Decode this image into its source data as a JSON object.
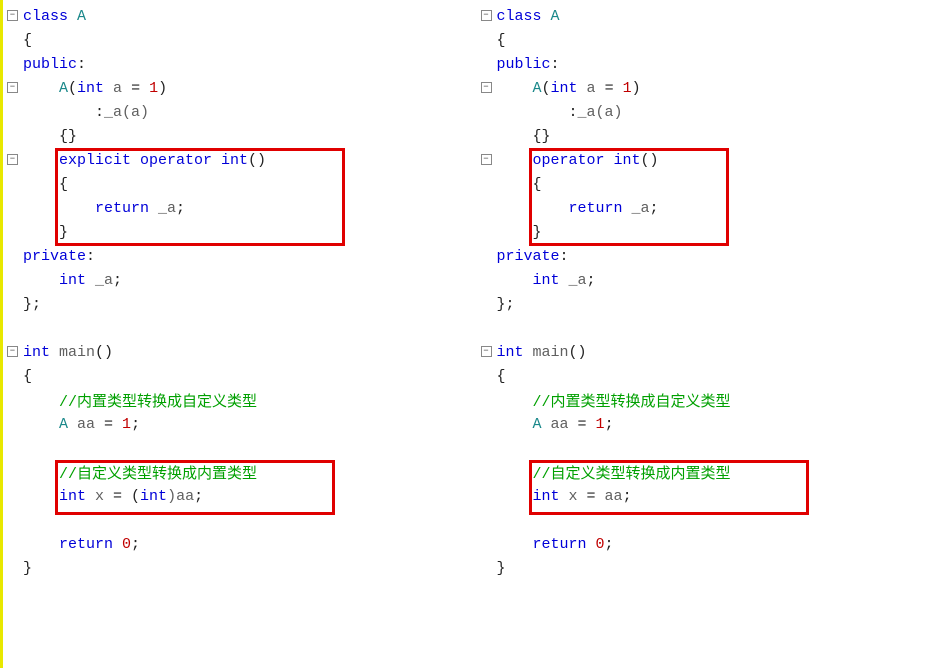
{
  "left": {
    "l1_kw": "class",
    "l1_cls": " A",
    "l2": "{",
    "l3_kw": "public",
    "l3_c": ":",
    "l4a_cls": "    A",
    "l4a_p1": "(",
    "l4a_kw": "int",
    "l4a_id": " a ",
    "l4a_eq": "= ",
    "l4a_num": "1",
    "l4a_p2": ")",
    "l5a": "        :",
    "l5b_id": "_a",
    "l5b_p": "(a)",
    "l6": "    {}",
    "l7_kw": "    explicit operator int",
    "l7_p": "()",
    "l8": "    {",
    "l9_kw": "        return",
    "l9_id": " _a",
    "l9_s": ";",
    "l10": "    }",
    "l11_kw": "private",
    "l11_c": ":",
    "l12_kw": "    int",
    "l12_id": " _a",
    "l12_s": ";",
    "l13": "};",
    "m1_kw": "int",
    "m1_id": " main",
    "m1_p": "()",
    "m2": "{",
    "m3_cmt": "    //内置类型转换成自定义类型",
    "m4_cls": "    A",
    "m4_id": " aa ",
    "m4_eq": "= ",
    "m4_num": "1",
    "m4_s": ";",
    "m5_cmt": "    //自定义类型转换成内置类型",
    "m6_kw": "    int",
    "m6_id": " x ",
    "m6_eq": "= (",
    "m6_kw2": "int",
    "m6_id2": ")aa",
    "m6_s": ";",
    "m7_kw": "    return",
    "m7_num": " 0",
    "m7_s": ";",
    "m8": "}"
  },
  "right": {
    "l1_kw": "class",
    "l1_cls": " A",
    "l2": "{",
    "l3_kw": "public",
    "l3_c": ":",
    "l4a_cls": "    A",
    "l4a_p1": "(",
    "l4a_kw": "int",
    "l4a_id": " a ",
    "l4a_eq": "= ",
    "l4a_num": "1",
    "l4a_p2": ")",
    "l5a": "        :",
    "l5b_id": "_a",
    "l5b_p": "(a)",
    "l6": "    {}",
    "l7_kw": "    operator int",
    "l7_p": "()",
    "l8": "    {",
    "l9_kw": "        return",
    "l9_id": " _a",
    "l9_s": ";",
    "l10": "    }",
    "l11_kw": "private",
    "l11_c": ":",
    "l12_kw": "    int",
    "l12_id": " _a",
    "l12_s": ";",
    "l13": "};",
    "m1_kw": "int",
    "m1_id": " main",
    "m1_p": "()",
    "m2": "{",
    "m3_cmt": "    //内置类型转换成自定义类型",
    "m4_cls": "    A",
    "m4_id": " aa ",
    "m4_eq": "= ",
    "m4_num": "1",
    "m4_s": ";",
    "m5_cmt": "    //自定义类型转换成内置类型",
    "m6_kw": "    int",
    "m6_id": " x ",
    "m6_eq": "= ",
    "m6_id2": "aa",
    "m6_s": ";",
    "m7_kw": "    return",
    "m7_num": " 0",
    "m7_s": ";",
    "m8": "}"
  },
  "fold_minus": "−"
}
